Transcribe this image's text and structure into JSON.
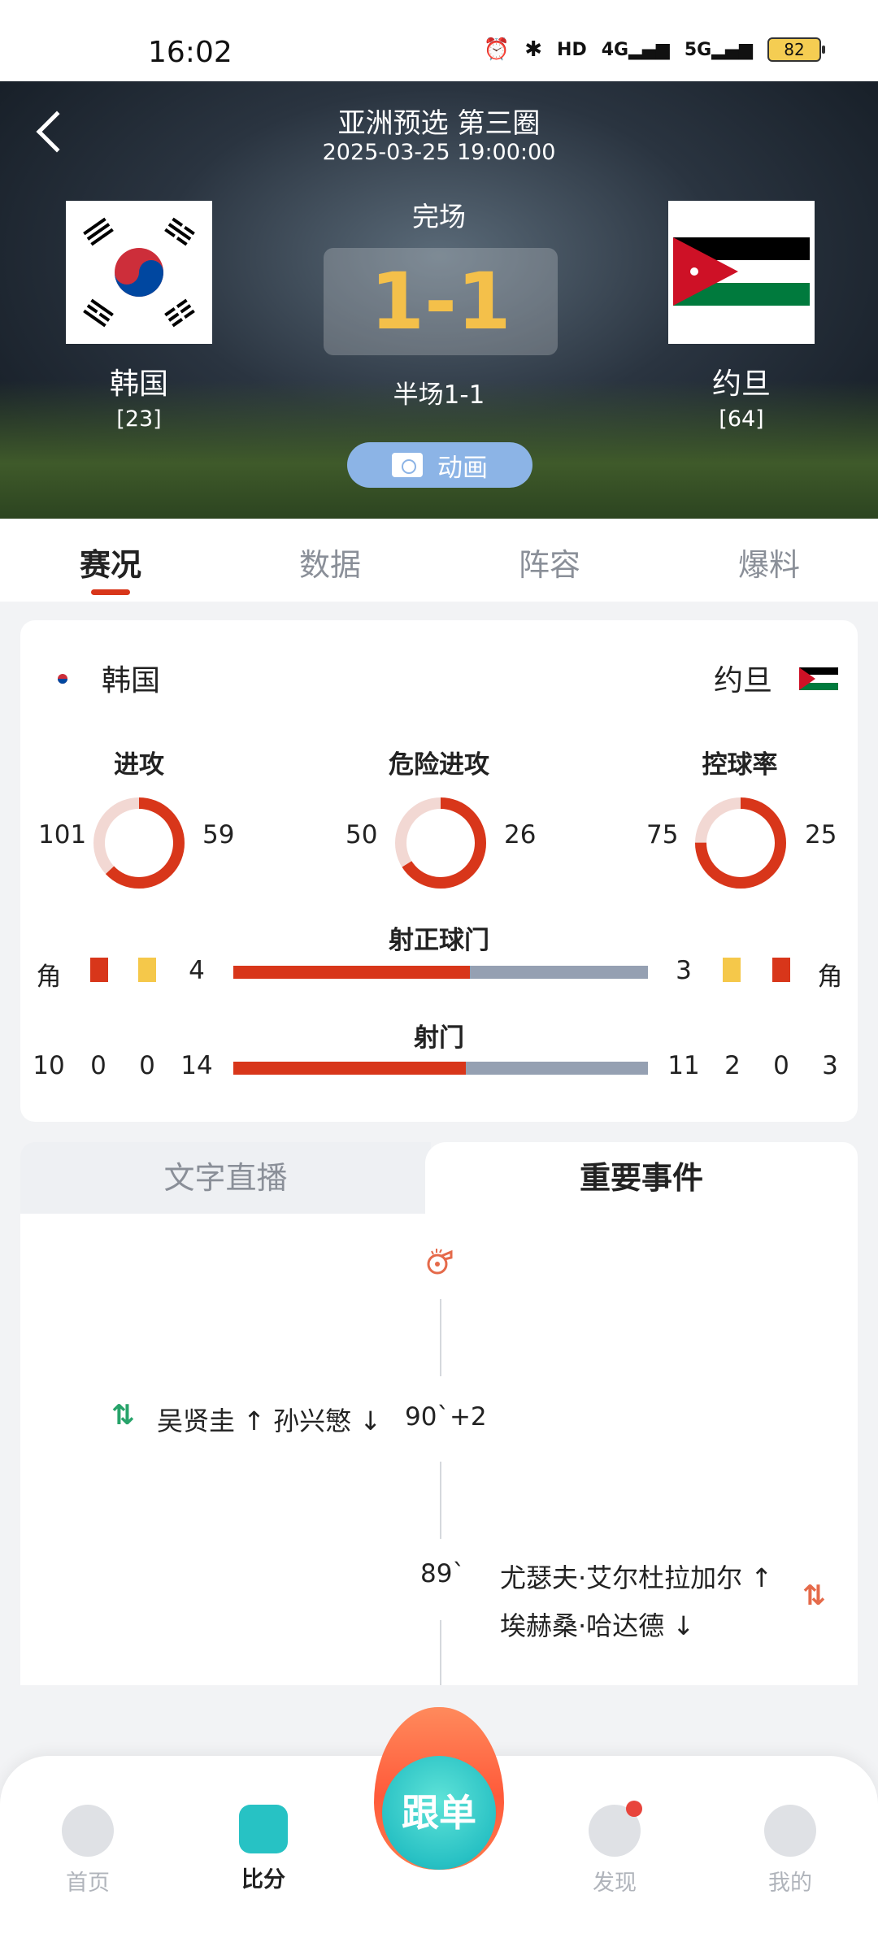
{
  "status_bar": {
    "time": "16:02",
    "battery": "82",
    "network1": "4G",
    "network2": "5G",
    "hd": "HD"
  },
  "match": {
    "league": "亚洲预选 第三圈",
    "datetime": "2025-03-25 19:00:00",
    "status": "完场",
    "score": "1-1",
    "halftime": "半场1-1",
    "animation_label": "动画",
    "home": {
      "name": "韩国",
      "rank": "[23]"
    },
    "away": {
      "name": "约旦",
      "rank": "[64]"
    }
  },
  "tabs": [
    "赛况",
    "数据",
    "阵容",
    "爆料"
  ],
  "stats": {
    "home_name": "韩国",
    "away_name": "约旦",
    "rings": [
      {
        "label": "进攻",
        "home": "101",
        "away": "59",
        "home_share": 0.63
      },
      {
        "label": "危险进攻",
        "home": "50",
        "away": "26",
        "home_share": 0.66
      },
      {
        "label": "控球率",
        "home": "75",
        "away": "25",
        "home_share": 0.75
      }
    ],
    "on_target": {
      "title": "射正球门",
      "home": "4",
      "away": "3",
      "home_share": 0.57,
      "corner_label": "角"
    },
    "shots": {
      "title": "射门",
      "home": "14",
      "away": "3",
      "home_share": 0.56,
      "home_extra": [
        "10",
        "0",
        "0"
      ],
      "away_extra": [
        "11",
        "2",
        "0"
      ]
    }
  },
  "events_tabs": {
    "left": "文字直播",
    "right": "重要事件"
  },
  "events": [
    {
      "minute": "90`+2",
      "text": "吴贤圭 ↑ 孙兴慜 ↓",
      "side": "home"
    },
    {
      "minute": "89`",
      "line1": "尤瑟夫·艾尔杜拉加尔 ↑",
      "line2": "埃赫桑·哈达德 ↓",
      "side": "away"
    }
  ],
  "nav": {
    "home": "首页",
    "score": "比分",
    "follow": "跟单",
    "discover": "发现",
    "mine": "我的"
  },
  "colors": {
    "accent": "#d8361a",
    "away_bar": "#95a0b2",
    "score": "#f4c04a",
    "teal": "#27c2c4"
  }
}
